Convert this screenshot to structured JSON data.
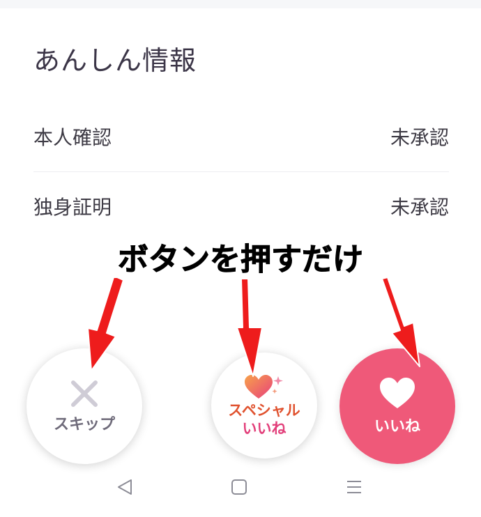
{
  "section": {
    "title": "あんしん情報"
  },
  "rows": [
    {
      "label": "本人確認",
      "value": "未承認"
    },
    {
      "label": "独身証明",
      "value": "未承認"
    }
  ],
  "annotation": {
    "caption": "ボタンを押すだけ",
    "arrow_color": "#ee1c1c"
  },
  "actions": {
    "skip": {
      "label": "スキップ",
      "icon": "close-icon"
    },
    "special": {
      "line1": "スペシャル",
      "line2": "いいね",
      "icon": "sparkle-heart-icon"
    },
    "like": {
      "label": "いいね",
      "icon": "heart-icon",
      "color": "#ef5979"
    }
  },
  "nav": {
    "icons": [
      "back-triangle-icon",
      "home-square-icon",
      "menu-lines-icon"
    ]
  }
}
